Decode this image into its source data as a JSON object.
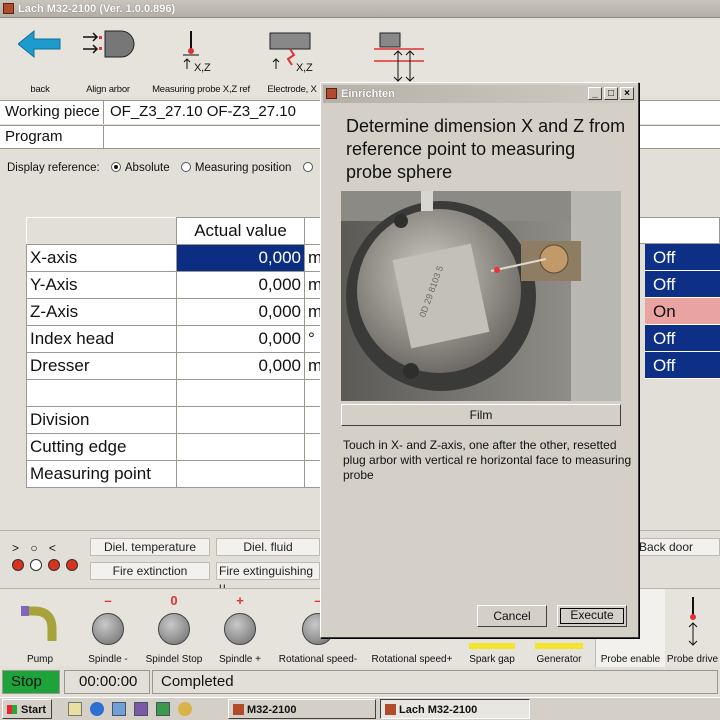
{
  "window": {
    "title": "Lach M32-2100 (Ver. 1.0.0.896)"
  },
  "toolbar": {
    "back": "back",
    "align_arbor": "Align arbor",
    "measuring_probe": "Measuring probe X,Z ref",
    "electrode": "Electrode, X",
    "xz_label": "X,Z"
  },
  "fields": {
    "working_piece_label": "Working piece",
    "working_piece_value": "OF_Z3_27.10  OF-Z3_27.10",
    "program_label": "Program",
    "program_value": ""
  },
  "display_reference": {
    "label": "Display reference:",
    "options": [
      "Absolute",
      "Measuring position"
    ],
    "selected": "Absolute"
  },
  "axes_table": {
    "header": "Actual value",
    "rows": [
      {
        "name": "X-axis",
        "value": "0,000",
        "unit": "m",
        "status": "Off"
      },
      {
        "name": "Y-Axis",
        "value": "0,000",
        "unit": "m",
        "status": "Off"
      },
      {
        "name": "Z-Axis",
        "value": "0,000",
        "unit": "m",
        "status": "On"
      },
      {
        "name": "Index head",
        "value": "0,000",
        "unit": "°",
        "status": "Off"
      },
      {
        "name": "Dresser",
        "value": "0,000",
        "unit": "m",
        "status": "Off"
      }
    ],
    "extra_rows": [
      "Division",
      "Cutting edge",
      "Measuring point"
    ]
  },
  "indicators": {
    "symbols": "> ○ <",
    "boxes": [
      "Diel. temperature",
      "Diel. fluid",
      "Fire extinction",
      "Fire extinguishing u"
    ],
    "back_door": "Back door"
  },
  "bottom_buttons": [
    {
      "label": "Pump",
      "mark": ""
    },
    {
      "label": "Spindle -",
      "mark": "–"
    },
    {
      "label": "Spindel Stop",
      "mark": "0"
    },
    {
      "label": "Spindle +",
      "mark": "+"
    },
    {
      "label": "Rotational speed-",
      "mark": "–"
    },
    {
      "label": "Rotational speed+",
      "mark": ""
    },
    {
      "label": "Spark gap",
      "mark": ""
    },
    {
      "label": "Generator",
      "mark": ""
    },
    {
      "label": "Probe enable",
      "mark": ""
    },
    {
      "label": "Probe drive",
      "mark": ""
    }
  ],
  "status": {
    "stop": "Stop",
    "time": "00:00:00",
    "state": "Completed"
  },
  "taskbar": {
    "start": "Start",
    "tasks": [
      "M32-2100",
      "Lach M32-2100"
    ]
  },
  "dialog": {
    "title": "Einrichten",
    "heading": "Determine dimension X and Z from reference point to measuring probe sphere",
    "film_button": "Film",
    "instructions": "Touch in X- and Z-axis, one after the other, resetted plug arbor with vertical re horizontal face to measuring probe",
    "cancel": "Cancel",
    "execute": "Execute"
  },
  "colors": {
    "selection": "#0c2e82",
    "on_status": "#e9a3a0",
    "stop_green": "#1ea33a",
    "lamp_red": "#d8331f",
    "accent_red": "#d33"
  }
}
